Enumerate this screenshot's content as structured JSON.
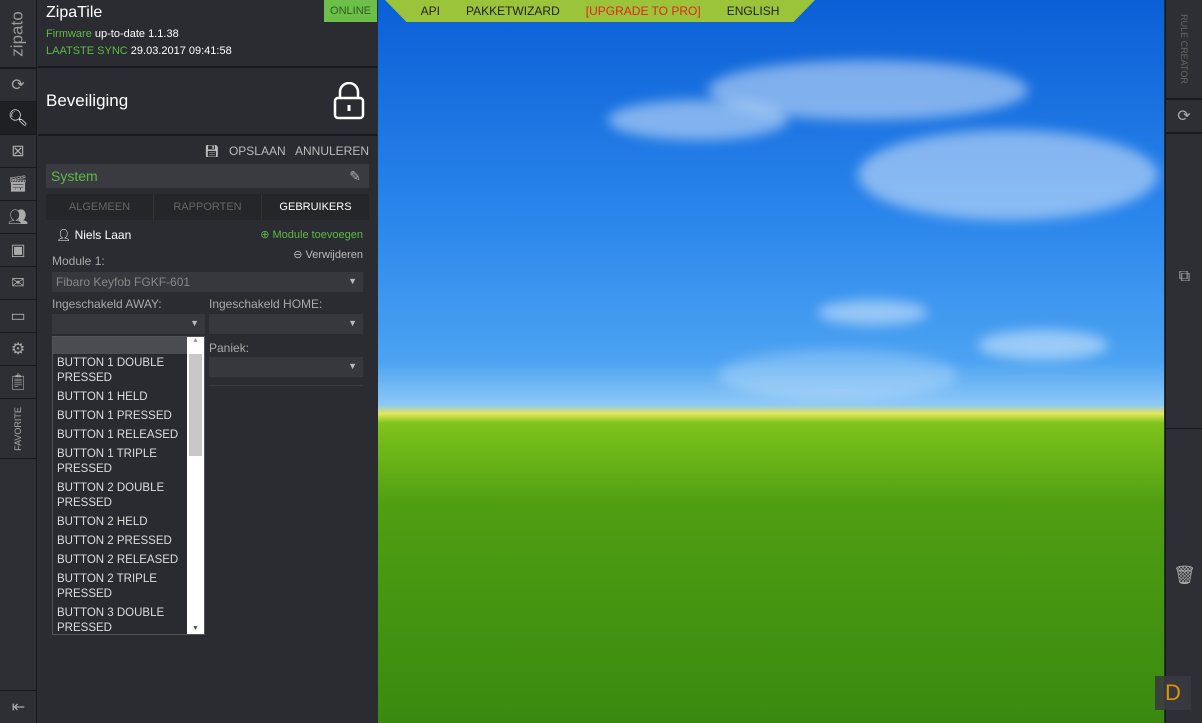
{
  "rail": {
    "logo": "zipato",
    "favorite": "FAVORITE"
  },
  "header": {
    "title": "ZipaTile",
    "status": "ONLINE",
    "firmware_label": "Firmware",
    "firmware_value": "up-to-date 1.1.38",
    "sync_label": "LAATSTE SYNC",
    "sync_value": "29.03.2017 09:41:58"
  },
  "section": {
    "title": "Beveiliging"
  },
  "actions": {
    "save": "OPSLAAN",
    "cancel": "ANNULEREN"
  },
  "system": {
    "name": "System"
  },
  "tabs": [
    {
      "label": "ALGEMEEN"
    },
    {
      "label": "RAPPORTEN"
    },
    {
      "label": "GEBRUIKERS"
    }
  ],
  "user": {
    "name": "Niels Laan",
    "add_module": "Module toevoegen",
    "remove": "Verwijderen"
  },
  "module": {
    "label": "Module 1:",
    "value": "Fibaro Keyfob FGKF-601"
  },
  "fields": {
    "away": "Ingeschakeld AWAY:",
    "home": "Ingeschakeld HOME:",
    "panic": "Paniek:"
  },
  "dropdown_options": [
    "BUTTON 1 DOUBLE PRESSED",
    "BUTTON 1 HELD",
    "BUTTON 1 PRESSED",
    "BUTTON 1 RELEASED",
    "BUTTON 1 TRIPLE PRESSED",
    "BUTTON 2 DOUBLE PRESSED",
    "BUTTON 2 HELD",
    "BUTTON 2 PRESSED",
    "BUTTON 2 RELEASED",
    "BUTTON 2 TRIPLE PRESSED",
    "BUTTON 3 DOUBLE PRESSED"
  ],
  "topnav": {
    "api": "API",
    "wizard": "PAKKETWIZARD",
    "upgrade": "[UPGRADE TO PRO]",
    "lang": "ENGLISH"
  },
  "right_rail": {
    "rule_creator": "RULE CREATOR"
  },
  "colors": {
    "accent": "#5dbb46",
    "online": "#6cc04a",
    "topnav": "#9cc43a",
    "upgrade": "#e0281a"
  }
}
